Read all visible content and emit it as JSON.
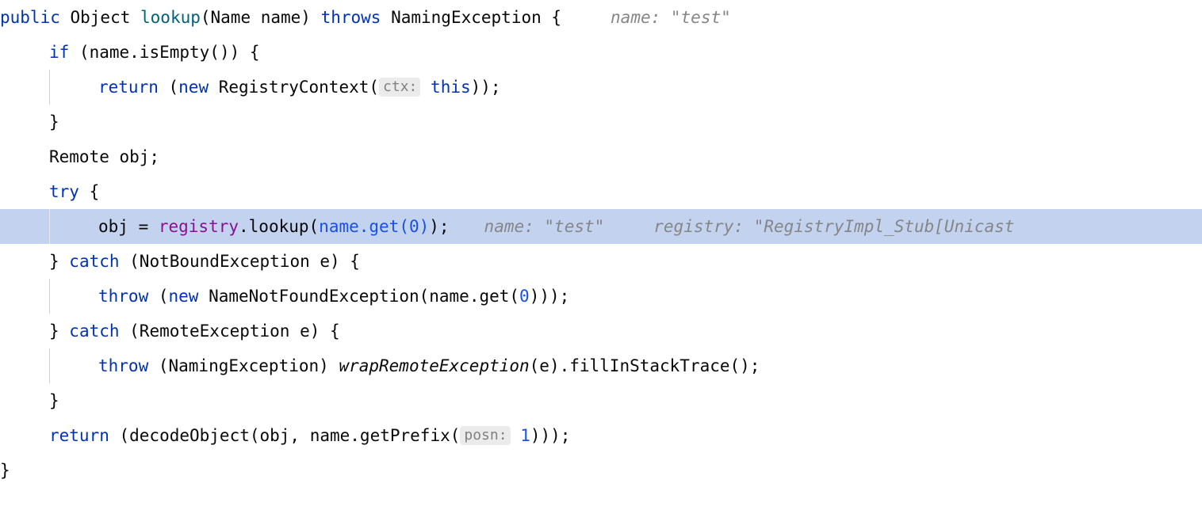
{
  "editor": {
    "language": "java",
    "theme": "IntelliJ Light",
    "colors": {
      "background": "#ffffff",
      "text": "#080808",
      "keyword": "#0033b3",
      "method_declaration": "#00627a",
      "field": "#871094",
      "number": "#1750eb",
      "inline_hint": "#868686",
      "param_hint_text": "#808080",
      "param_hint_chip": "#ebebeb",
      "execution_line_highlight": "#c3d3ef",
      "indent_guide": "#d0d0d0"
    },
    "lines": [
      {
        "n": 1,
        "indent": 0,
        "highlight": false,
        "guide": false,
        "tokens": [
          {
            "t": "public",
            "c": "kw"
          },
          {
            "t": " Object ",
            "c": "plain"
          },
          {
            "t": "lookup",
            "c": "mdecl"
          },
          {
            "t": "(Name name) ",
            "c": "plain"
          },
          {
            "t": "throws",
            "c": "kw"
          },
          {
            "t": " NamingException {",
            "c": "plain"
          }
        ],
        "value_hint": "name: \"test\"",
        "value_hint_gap": "gapB"
      },
      {
        "n": 2,
        "indent": 1,
        "highlight": false,
        "guide": false,
        "tokens": [
          {
            "t": "if",
            "c": "kw"
          },
          {
            "t": " (name.isEmpty()) {",
            "c": "plain"
          }
        ],
        "value_hint": "",
        "value_hint_gap": ""
      },
      {
        "n": 3,
        "indent": 2,
        "highlight": false,
        "guide": true,
        "tokens": [
          {
            "t": "return",
            "c": "kw"
          },
          {
            "t": " (",
            "c": "plain"
          },
          {
            "t": "new",
            "c": "kw"
          },
          {
            "t": " RegistryContext(",
            "c": "plain"
          },
          {
            "t": "ctx:",
            "c": "phint"
          },
          {
            "t": " ",
            "c": "plain"
          },
          {
            "t": "this",
            "c": "kw"
          },
          {
            "t": "));",
            "c": "plain"
          }
        ],
        "value_hint": "",
        "value_hint_gap": ""
      },
      {
        "n": 4,
        "indent": 1,
        "highlight": false,
        "guide": false,
        "tokens": [
          {
            "t": "}",
            "c": "plain"
          }
        ],
        "value_hint": "",
        "value_hint_gap": ""
      },
      {
        "n": 5,
        "indent": 1,
        "highlight": false,
        "guide": false,
        "tokens": [
          {
            "t": "Remote obj;",
            "c": "plain"
          }
        ],
        "value_hint": "",
        "value_hint_gap": ""
      },
      {
        "n": 6,
        "indent": 1,
        "highlight": false,
        "guide": false,
        "tokens": [
          {
            "t": "try",
            "c": "kw"
          },
          {
            "t": " {",
            "c": "plain"
          }
        ],
        "value_hint": "",
        "value_hint_gap": ""
      },
      {
        "n": 7,
        "indent": 2,
        "highlight": true,
        "guide": true,
        "tokens": [
          {
            "t": "obj = ",
            "c": "plain"
          },
          {
            "t": "registry",
            "c": "field"
          },
          {
            "t": ".lookup(",
            "c": "plain"
          },
          {
            "t": "name.get(0)",
            "c": "bluecall"
          },
          {
            "t": ");",
            "c": "plain"
          }
        ],
        "value_hint": "name: \"test\"",
        "value_hint_gap": "gapA",
        "value_hint_2": "registry: \"RegistryImpl_Stub[Unicast",
        "value_hint_2_gap": "gapB"
      },
      {
        "n": 8,
        "indent": 1,
        "highlight": false,
        "guide": false,
        "tokens": [
          {
            "t": "} ",
            "c": "plain"
          },
          {
            "t": "catch",
            "c": "kw"
          },
          {
            "t": " (NotBoundException e) {",
            "c": "plain"
          }
        ],
        "value_hint": "",
        "value_hint_gap": ""
      },
      {
        "n": 9,
        "indent": 2,
        "highlight": false,
        "guide": true,
        "tokens": [
          {
            "t": "throw",
            "c": "kw"
          },
          {
            "t": " (",
            "c": "plain"
          },
          {
            "t": "new",
            "c": "kw"
          },
          {
            "t": " NameNotFoundException(name.get(",
            "c": "plain"
          },
          {
            "t": "0",
            "c": "num"
          },
          {
            "t": ")));",
            "c": "plain"
          }
        ],
        "value_hint": "",
        "value_hint_gap": ""
      },
      {
        "n": 10,
        "indent": 1,
        "highlight": false,
        "guide": false,
        "tokens": [
          {
            "t": "} ",
            "c": "plain"
          },
          {
            "t": "catch",
            "c": "kw"
          },
          {
            "t": " (RemoteException e) {",
            "c": "plain"
          }
        ],
        "value_hint": "",
        "value_hint_gap": ""
      },
      {
        "n": 11,
        "indent": 2,
        "highlight": false,
        "guide": true,
        "tokens": [
          {
            "t": "throw",
            "c": "kw"
          },
          {
            "t": " (NamingException) ",
            "c": "plain"
          },
          {
            "t": "wrapRemoteException",
            "c": "ital"
          },
          {
            "t": "(e).fillInStackTrace();",
            "c": "plain"
          }
        ],
        "value_hint": "",
        "value_hint_gap": ""
      },
      {
        "n": 12,
        "indent": 1,
        "highlight": false,
        "guide": false,
        "tokens": [
          {
            "t": "}",
            "c": "plain"
          }
        ],
        "value_hint": "",
        "value_hint_gap": ""
      },
      {
        "n": 13,
        "indent": 1,
        "highlight": false,
        "guide": false,
        "tokens": [
          {
            "t": "return",
            "c": "kw"
          },
          {
            "t": " (decodeObject(obj, name.getPrefix(",
            "c": "plain"
          },
          {
            "t": "posn:",
            "c": "phint"
          },
          {
            "t": " ",
            "c": "plain"
          },
          {
            "t": "1",
            "c": "num"
          },
          {
            "t": ")));",
            "c": "plain"
          }
        ],
        "value_hint": "",
        "value_hint_gap": ""
      },
      {
        "n": 14,
        "indent": 0,
        "highlight": false,
        "guide": false,
        "tokens": [
          {
            "t": "}",
            "c": "plain"
          }
        ],
        "value_hint": "",
        "value_hint_gap": ""
      }
    ]
  }
}
